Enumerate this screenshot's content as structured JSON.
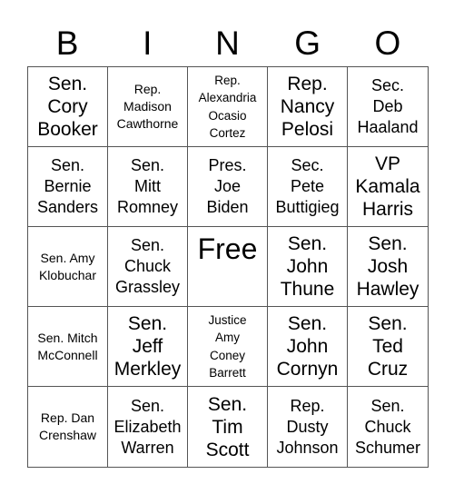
{
  "header": [
    "B",
    "I",
    "N",
    "G",
    "O"
  ],
  "cells": [
    {
      "text": "Sen.\nCory\nBooker",
      "size": "lg"
    },
    {
      "text": "Rep.\nMadison\nCawthorne",
      "size": "sm"
    },
    {
      "text": "Rep.\nAlexandria\nOcasio\nCortez",
      "size": "xs"
    },
    {
      "text": "Rep.\nNancy\nPelosi",
      "size": "lg"
    },
    {
      "text": "Sec.\nDeb\nHaaland",
      "size": "md"
    },
    {
      "text": "Sen.\nBernie\nSanders",
      "size": "md"
    },
    {
      "text": "Sen.\nMitt\nRomney",
      "size": "md"
    },
    {
      "text": "Pres.\nJoe\nBiden",
      "size": "md"
    },
    {
      "text": "Sec.\nPete\nButtigieg",
      "size": "md"
    },
    {
      "text": "VP\nKamala\nHarris",
      "size": "lg"
    },
    {
      "text": "Sen. Amy\nKlobuchar",
      "size": "sm"
    },
    {
      "text": "Sen.\nChuck\nGrassley",
      "size": "md"
    },
    {
      "text": "Free",
      "size": "free"
    },
    {
      "text": "Sen.\nJohn\nThune",
      "size": "lg"
    },
    {
      "text": "Sen.\nJosh\nHawley",
      "size": "lg"
    },
    {
      "text": "Sen. Mitch\nMcConnell",
      "size": "sm"
    },
    {
      "text": "Sen.\nJeff\nMerkley",
      "size": "lg"
    },
    {
      "text": "Justice\nAmy\nConey\nBarrett",
      "size": "xs"
    },
    {
      "text": "Sen.\nJohn\nCornyn",
      "size": "lg"
    },
    {
      "text": "Sen.\nTed\nCruz",
      "size": "lg"
    },
    {
      "text": "Rep. Dan\nCrenshaw",
      "size": "sm"
    },
    {
      "text": "Sen.\nElizabeth\nWarren",
      "size": "md"
    },
    {
      "text": "Sen.\nTim\nScott",
      "size": "lg"
    },
    {
      "text": "Rep.\nDusty\nJohnson",
      "size": "md"
    },
    {
      "text": "Sen.\nChuck\nSchumer",
      "size": "md"
    }
  ]
}
